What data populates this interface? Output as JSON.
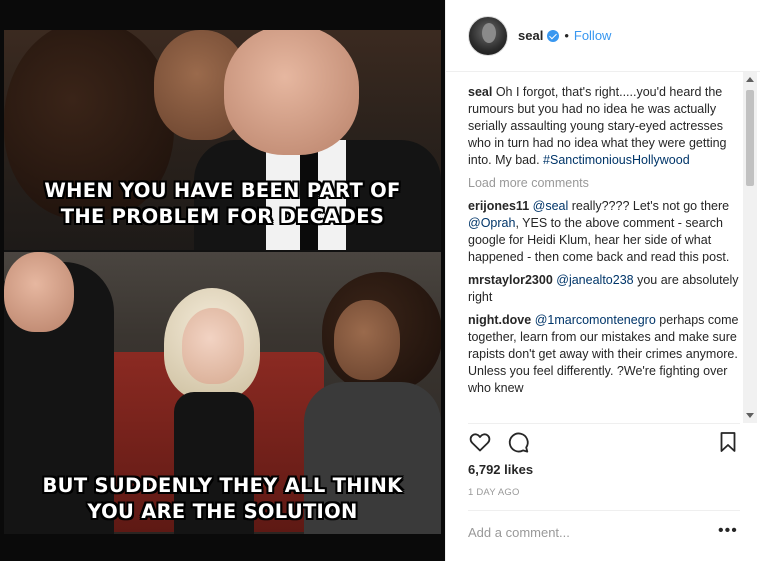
{
  "header": {
    "username": "seal",
    "separator": "•",
    "follow_label": "Follow"
  },
  "meme": {
    "top_line1": "WHEN YOU HAVE BEEN PART OF",
    "top_line2": "THE PROBLEM FOR DECADES",
    "bottom_line1": "BUT SUDDENLY THEY ALL THINK",
    "bottom_line2": "YOU ARE THE SOLUTION"
  },
  "caption": {
    "username": "seal",
    "text": "Oh I forgot, that's right.....you'd heard the rumours but you had no idea he was actually serially assaulting young stary-eyed actresses who in turn had no idea what they were getting into. My bad. ",
    "hashtag": "#SanctimoniousHollywood"
  },
  "load_more_label": "Load more comments",
  "comments": [
    {
      "username": "erijones11",
      "text_before": " ",
      "mention1": "@seal",
      "text_mid": " really???? Let's not go there ",
      "mention2": "@Oprah",
      "text_after": ", YES to the above comment - search google for Heidi Klum, hear her side of what happened - then come back and read this post."
    },
    {
      "username": "mrstaylor2300",
      "text_before": " ",
      "mention1": "@janealto238",
      "text_after": " you are absolutely right"
    },
    {
      "username": "night.dove",
      "text_before": " ",
      "mention1": "@1marcomontenegro",
      "text_after": " perhaps come together, learn from our mistakes and make sure rapists don't get away with their crimes anymore. Unless you feel differently. ?We're fighting over who knew"
    }
  ],
  "likes_text": "6,792 likes",
  "timestamp": "1 DAY AGO",
  "add_comment_placeholder": "Add a comment...",
  "more_options": "•••",
  "icons": {
    "like": "heart-icon",
    "comment": "comment-icon",
    "save": "bookmark-icon",
    "verified": "verified-badge-icon"
  },
  "colors": {
    "accent": "#3897f0",
    "link": "#003569",
    "muted": "#999999",
    "text": "#262626"
  }
}
